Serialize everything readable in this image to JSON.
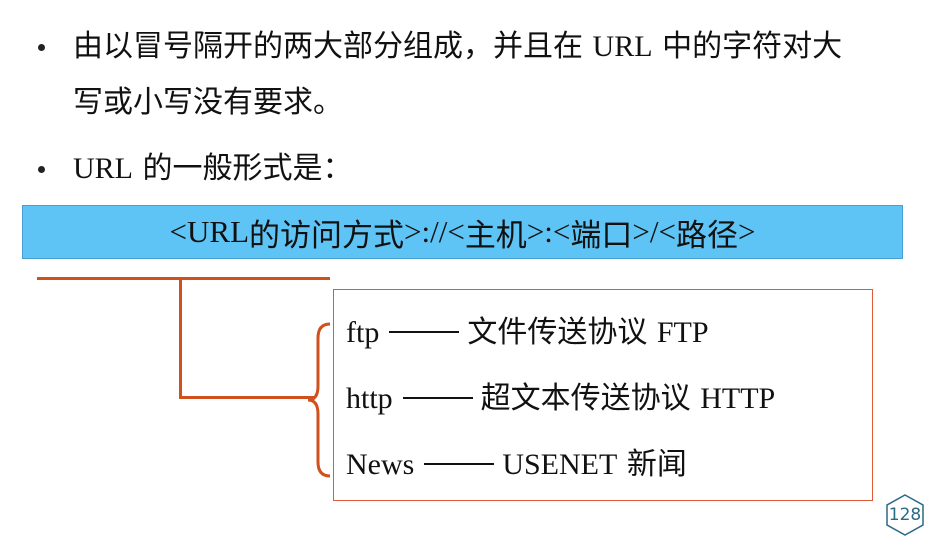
{
  "bullets": [
    {
      "parts": [
        "由以冒号隔开的两大部分组成，并且在 ",
        "URL",
        " 中的字符对大"
      ],
      "line2": "写或小写没有要求。"
    },
    {
      "parts": [
        "URL",
        " 的一般形式是："
      ]
    }
  ],
  "url_format": {
    "open1": "<",
    "text1": "URL",
    "text2": "的访问方式",
    "sep1": ">://<",
    "text3": "主机",
    "sep2": ">:<",
    "text4": "端口",
    "sep3": ">/<",
    "text5": "路径",
    "close": ">"
  },
  "protocols": [
    {
      "name": "ftp",
      "desc": "文件传送协议",
      "abbr": "FTP"
    },
    {
      "name": "http",
      "desc": "超文本传送协议",
      "abbr": "HTTP"
    },
    {
      "name": "News",
      "desc": "",
      "abbr": "USENET",
      "desc2": "新闻"
    }
  ],
  "page_number": "128",
  "colors": {
    "box_fill": "#5ec3f5",
    "connector": "#d0501e",
    "page_badge": "#2b6a86"
  }
}
